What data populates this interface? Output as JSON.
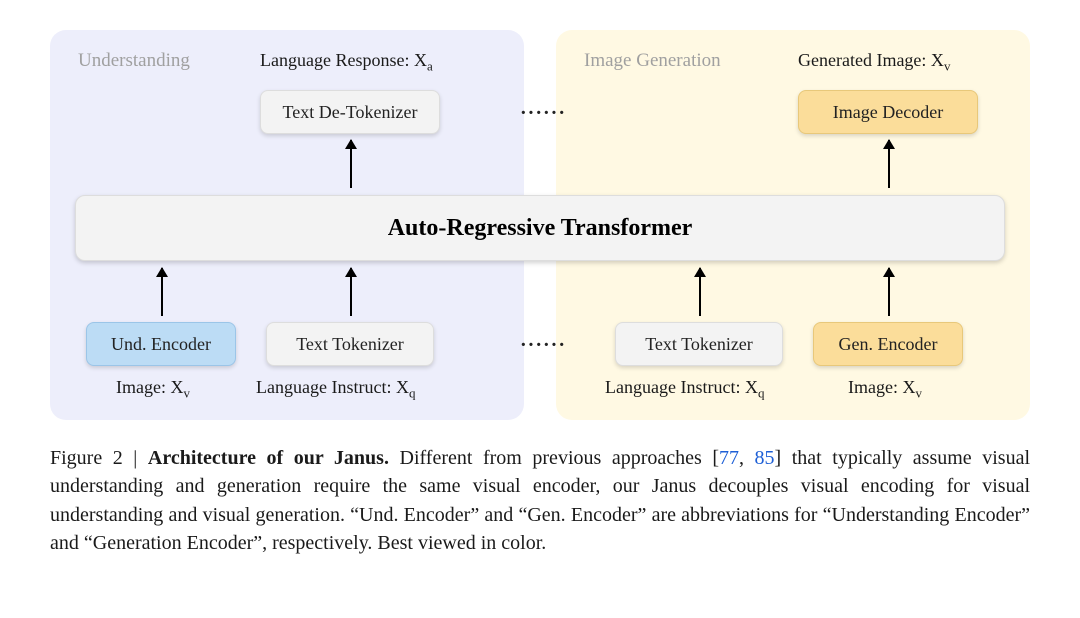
{
  "diagram": {
    "left_section_title": "Understanding",
    "right_section_title": "Image Generation",
    "left_output_label": "Language Response: X",
    "left_output_sub": "a",
    "right_output_label": "Generated Image: X",
    "right_output_sub": "v",
    "text_detokenizer": "Text De-Tokenizer",
    "image_decoder": "Image Decoder",
    "transformer": "Auto-Regressive Transformer",
    "und_encoder": "Und. Encoder",
    "text_tokenizer_left": "Text Tokenizer",
    "text_tokenizer_right": "Text Tokenizer",
    "gen_encoder": "Gen. Encoder",
    "dots": "······",
    "left_input_image": "Image: X",
    "left_input_image_sub": "v",
    "left_input_lang": "Language Instruct: X",
    "left_input_lang_sub": "q",
    "right_input_lang": "Language Instruct: X",
    "right_input_lang_sub": "q",
    "right_input_image": "Image: X",
    "right_input_image_sub": "v"
  },
  "caption": {
    "prefix": "Figure 2 | ",
    "bold": "Architecture of our Janus.",
    "text1": " Different from previous approaches [",
    "ref1": "77",
    "comma": ", ",
    "ref2": "85",
    "text2": "] that typically assume visual understanding and generation require the same visual encoder, our Janus decouples visual encoding for visual understanding and visual generation. “Und. Encoder” and “Gen. Encoder” are abbreviations for “Understanding Encoder” and “Generation Encoder”, respectively. Best viewed in color."
  }
}
